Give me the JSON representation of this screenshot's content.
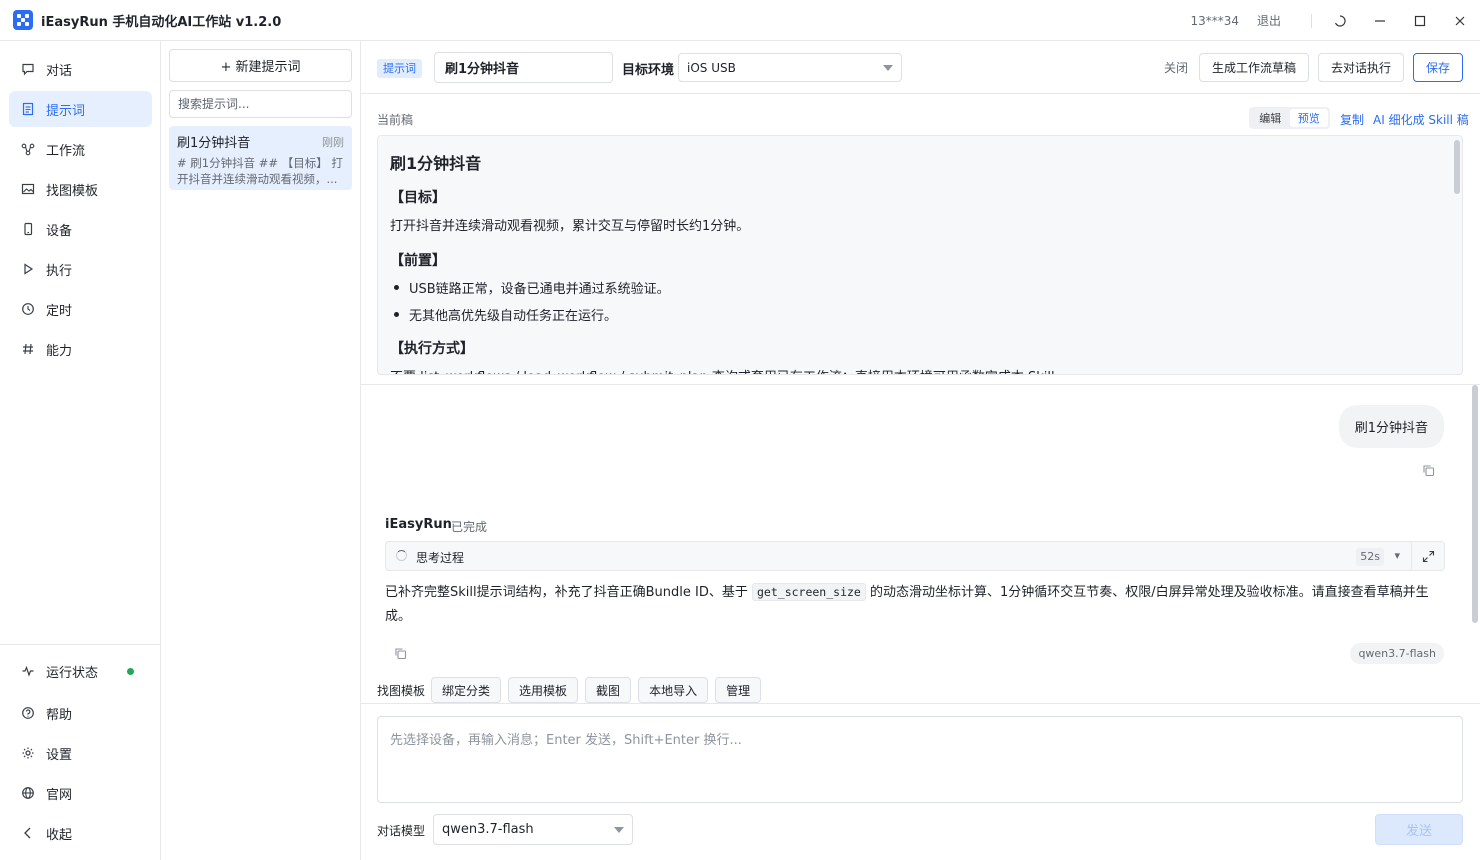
{
  "app": {
    "title": "iEasyRun 手机自动化AI工作站 v1.2.0",
    "user": "13***34",
    "logout": "退出",
    "accent": "#2a6df4"
  },
  "sidebar": {
    "items": [
      {
        "label": "对话",
        "icon": "chat-icon"
      },
      {
        "label": "提示词",
        "icon": "document-icon",
        "active": true
      },
      {
        "label": "工作流",
        "icon": "workflow-icon"
      },
      {
        "label": "找图模板",
        "icon": "image-icon"
      },
      {
        "label": "设备",
        "icon": "phone-icon"
      },
      {
        "label": "执行",
        "icon": "play-icon"
      },
      {
        "label": "定时",
        "icon": "clock-icon"
      },
      {
        "label": "能力",
        "icon": "hash-icon"
      }
    ],
    "bottom": [
      {
        "label": "运行状态",
        "icon": "pulse-icon"
      },
      {
        "label": "帮助",
        "icon": "help-icon"
      },
      {
        "label": "设置",
        "icon": "settings-icon"
      },
      {
        "label": "官网",
        "icon": "globe-icon"
      },
      {
        "label": "收起",
        "icon": "collapse-icon"
      }
    ]
  },
  "prompt_list": {
    "new_button": "+ 新建提示词",
    "search_placeholder": "搜索提示词...",
    "items": [
      {
        "title": "刷1分钟抖音",
        "time": "刚刚",
        "snippet": "# 刷1分钟抖音 ## 【目标】 打开抖音并连续滑动观看视频，..."
      }
    ]
  },
  "editor": {
    "tag": "提示词",
    "name_value": "刷1分钟抖音",
    "env_label": "目标环境",
    "env_value": "iOS USB",
    "close": "关闭",
    "gen_workflow": "生成工作流草稿",
    "to_chat": "去对话执行",
    "save": "保存",
    "draft_label": "当前稿",
    "mode_edit": "编辑",
    "mode_preview": "预览",
    "copy": "复制",
    "ai_refine": "AI 细化成 Skill 稿"
  },
  "preview": {
    "h1": "刷1分钟抖音",
    "goal_heading": "【目标】",
    "goal_text": "打开抖音并连续滑动观看视频，累计交互与停留时长约1分钟。",
    "pre_heading": "【前置】",
    "pre_items": [
      "USB链路正常，设备已通电并通过系统验证。",
      "无其他高优先级自动任务正在运行。"
    ],
    "exec_heading": "【执行方式】",
    "exec_text": "不要 list_workflows / load_workflow / submit_plan 查询或套用已有工作流；直接用本环境可用函数完成本 Skill。"
  },
  "chat": {
    "user_message": "刷1分钟抖音",
    "bot_name": "iEasyRun",
    "bot_status": "已完成",
    "thinking_label": "思考过程",
    "thinking_time": "52s",
    "reply_part1": "已补齐完整Skill提示词结构，补充了抖音正确Bundle ID、基于",
    "reply_code": "get_screen_size",
    "reply_part2": "的动态滑动坐标计算、1分钟循环交互节奏、权限/白屏异常处理及验收标准。请直接查看草稿并生成。",
    "model_tag": "qwen3.7-flash"
  },
  "tools": {
    "label": "找图模板",
    "chips": [
      "绑定分类",
      "选用模板",
      "截图",
      "本地导入",
      "管理"
    ]
  },
  "composer": {
    "placeholder": "先选择设备，再输入消息；Enter 发送，Shift+Enter 换行...",
    "model_label": "对话模型",
    "model_value": "qwen3.7-flash",
    "send": "发送"
  }
}
